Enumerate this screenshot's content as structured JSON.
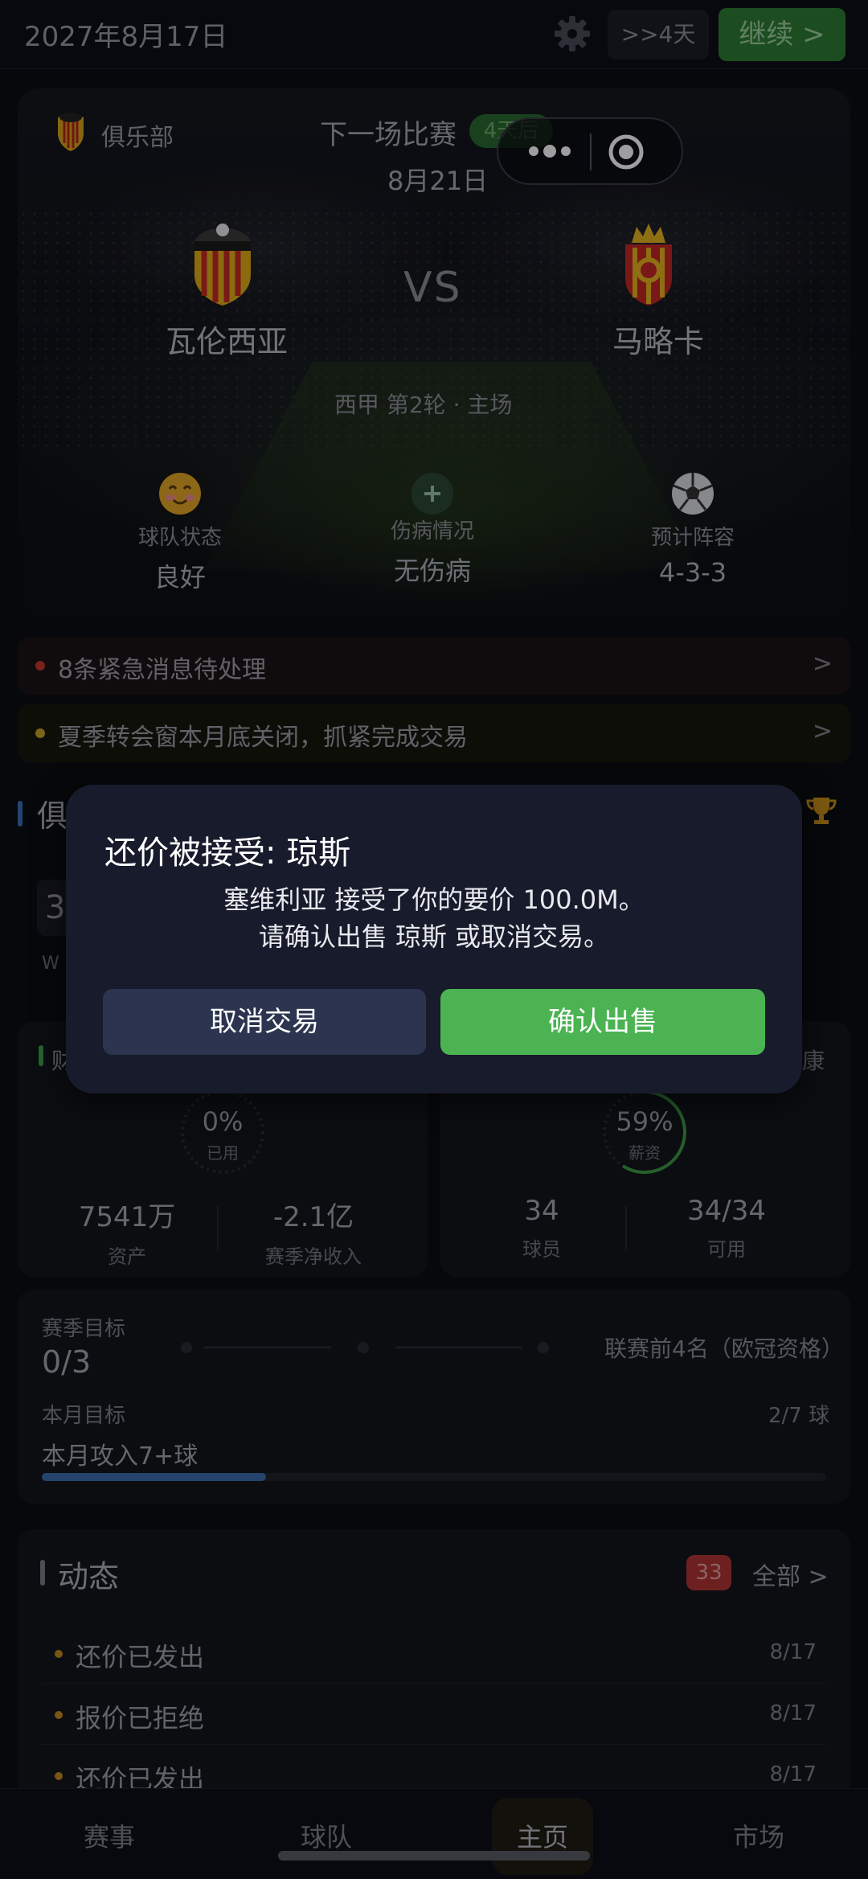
{
  "topbar": {
    "date": "2027年8月17日",
    "skip_label": ">>4天",
    "continue_label": "继续 >"
  },
  "hero": {
    "club_label": "俱乐部",
    "next_match_label": "下一场比赛",
    "days_badge": "4天后",
    "match_date": "8月21日",
    "home_team": "瓦伦西亚",
    "away_team": "马略卡",
    "vs": "VS",
    "league_info": "西甲 第2轮 · 主场",
    "stats": [
      {
        "label": "球队状态",
        "value": "良好",
        "icon": "smile-face-icon"
      },
      {
        "label": "伤病情况",
        "value": "无伤病",
        "icon": "plus-icon"
      },
      {
        "label": "预计阵容",
        "value": "4-3-3",
        "icon": "soccer-ball-icon"
      }
    ]
  },
  "notices": [
    {
      "text": "8条紧急消息待处理",
      "arrow": ">",
      "color": "#c0392b"
    },
    {
      "text": "夏季转会窗本月底关闭，抓紧完成交易",
      "arrow": ">",
      "color": "#c9a227"
    }
  ],
  "club_section": {
    "title_partial": "俱",
    "num_partial": "3",
    "w_partial": "W"
  },
  "finance": {
    "title_partial": "财",
    "ring_value": "0%",
    "ring_caption": "已用",
    "ring_fill": 0,
    "assets_value": "7541万",
    "assets_label": "资产",
    "net_value": "-2.1亿",
    "net_label": "赛季净收入"
  },
  "squad": {
    "title_partial": "康",
    "ring_value": "59%",
    "ring_caption": "薪资",
    "ring_fill": 0.59,
    "players_value": "34",
    "players_label": "球员",
    "available_value": "34/34",
    "available_label": "可用"
  },
  "goals": {
    "season_label": "赛季目标",
    "season_progress": "0/3",
    "season_goal": "联赛前4名（欧冠资格）",
    "month_label": "本月目标",
    "month_count": "2/7 球",
    "month_task": "本月攻入7+球",
    "month_progress": 0.2857
  },
  "activity": {
    "title": "动态",
    "count": "33",
    "all_label": "全部 >",
    "items": [
      {
        "text": "还价已发出",
        "date": "8/17"
      },
      {
        "text": "报价已拒绝",
        "date": "8/17"
      },
      {
        "text": "还价已发出",
        "date": "8/17"
      }
    ]
  },
  "nav": {
    "items": [
      "赛事",
      "球队",
      "主页",
      "市场"
    ],
    "active": "主页"
  },
  "modal": {
    "title": "还价被接受: 琼斯",
    "line1": "塞维利亚 接受了你的要价 100.0M。",
    "line2": "请确认出售 琼斯 或取消交易。",
    "cancel_label": "取消交易",
    "confirm_label": "确认出售"
  },
  "colors": {
    "accent_green": "#4bb352",
    "cancel_bg": "#2c3450",
    "modal_bg": "#171b2b"
  }
}
